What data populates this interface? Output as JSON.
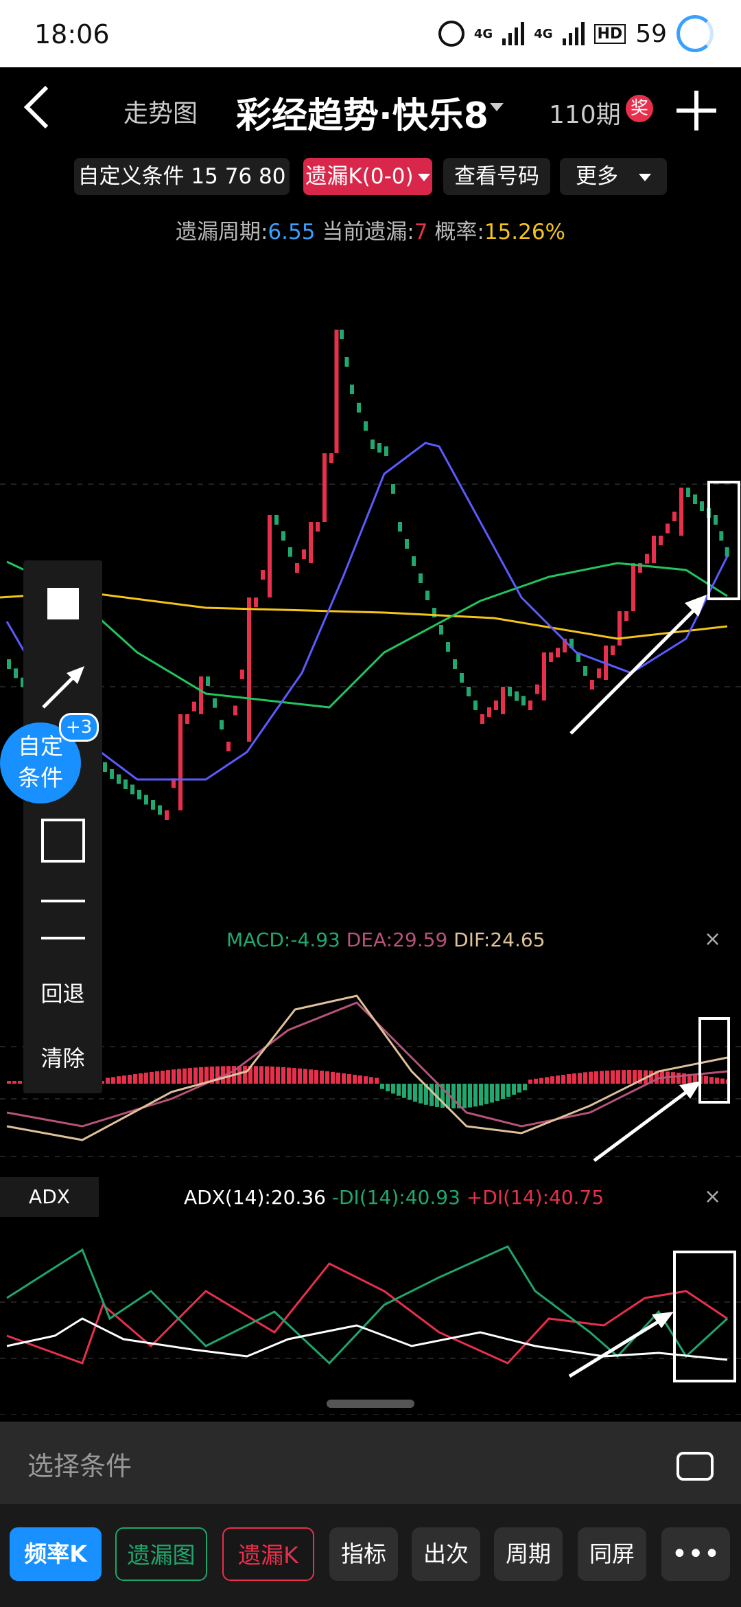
{
  "status_bar": {
    "time": "18:06",
    "net_label": "4G",
    "battery": "59"
  },
  "header": {
    "trend_link": "走势图",
    "title": "彩经趋势·快乐8",
    "issue_count": "110期",
    "award_badge": "奖"
  },
  "chips": {
    "custom_condition": "自定义条件 15 76 80",
    "miss_k": "遗漏K(0-0)",
    "view_numbers": "查看号码",
    "more": "更多"
  },
  "stats": {
    "period_label": "遗漏周期:",
    "period_value": "6.55",
    "current_label": "当前遗漏:",
    "current_value": "7",
    "prob_label": "概率:",
    "prob_value": "15.26%"
  },
  "draw_tools": {
    "undo": "回退",
    "clear": "清除"
  },
  "fab": {
    "line1": "自定",
    "line2": "条件",
    "badge": "+3"
  },
  "macd": {
    "macd_label": "MACD:",
    "macd_value": "-4.93",
    "dea_label": "DEA:",
    "dea_value": "29.59",
    "dif_label": "DIF:",
    "dif_value": "24.65",
    "close": "×"
  },
  "adx": {
    "tag": "ADX",
    "adx_label": "ADX(14):",
    "adx_value": "20.36",
    "mdi_label": "-DI(14):",
    "mdi_value": "40.93",
    "pdi_label": "+DI(14):",
    "pdi_value": "40.75",
    "close": "×"
  },
  "bottom": {
    "placeholder": "选择条件"
  },
  "buttons": [
    "频率K",
    "遗漏图",
    "遗漏K",
    "指标",
    "出次",
    "周期",
    "同屏",
    "•••"
  ],
  "colors": {
    "red": "#e8304c",
    "green": "#21a86f",
    "blue": "#1890ff",
    "yellow": "#f5c518",
    "accent_blue_text": "#3aa0ff"
  }
}
